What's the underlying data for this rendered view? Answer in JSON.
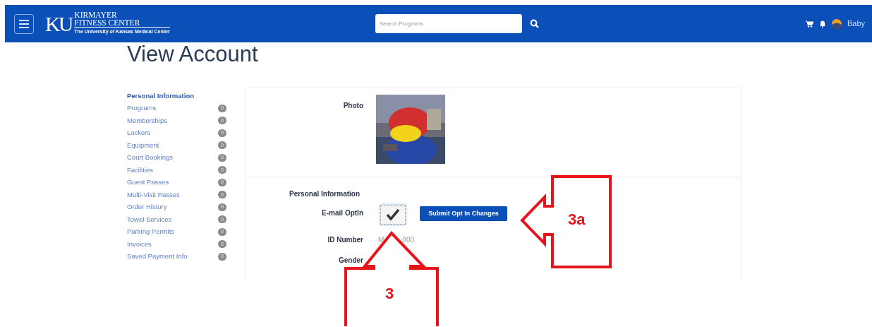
{
  "navbar": {
    "logo_mark": "KU",
    "logo_title_1": "KIRMAYER",
    "logo_title_2": "FITNESS CENTER",
    "logo_subtitle": "The University of Kansas Medical Center",
    "search": {
      "placeholder": "Search Programs"
    },
    "user": "Baby"
  },
  "page_title": "View Account",
  "sidebar": {
    "items": [
      {
        "label": "Personal Information",
        "selected": true
      },
      {
        "label": "Programs",
        "count": "0",
        "selected": false
      },
      {
        "label": "Memberships",
        "count": "0",
        "selected": false
      },
      {
        "label": "Lockers",
        "count": "0",
        "selected": false
      },
      {
        "label": "Equipment",
        "count": "0",
        "selected": false
      },
      {
        "label": "Court Bookings",
        "count": "0",
        "selected": false
      },
      {
        "label": "Facilities",
        "count": "0",
        "selected": false
      },
      {
        "label": "Guest Passes",
        "count": "0",
        "selected": false
      },
      {
        "label": "Multi-Visit Passes",
        "count": "0",
        "selected": false
      },
      {
        "label": "Order History",
        "count": "0",
        "selected": false
      },
      {
        "label": "Towel Services",
        "count": "0",
        "selected": false
      },
      {
        "label": "Parking Permits",
        "count": "0",
        "selected": false
      },
      {
        "label": "Invoices",
        "count": "0",
        "selected": false
      },
      {
        "label": "Saved Payment Info",
        "count": "0",
        "selected": false
      }
    ]
  },
  "photo": {
    "label": "Photo",
    "kind": "picture"
  },
  "personal_information": {
    "heading": "Personal Information",
    "email_optin": {
      "label": "E-mail OptIn",
      "checked": true,
      "button": "Submit Opt In Changes"
    },
    "id_number": {
      "label": "ID Number",
      "value_parts": [
        "M",
        "000"
      ]
    },
    "gender": {
      "label": "Gender"
    }
  },
  "callouts": [
    {
      "label": "3",
      "kind": "up"
    },
    {
      "label": "3a",
      "kind": "left"
    }
  ]
}
